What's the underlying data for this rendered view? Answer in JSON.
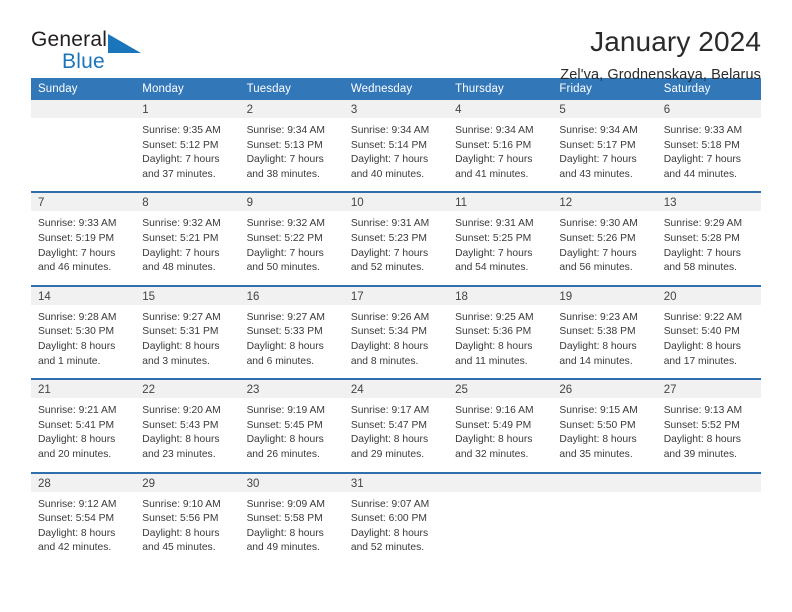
{
  "brand": {
    "name_part1": "General",
    "name_part2": "Blue",
    "accent_color": "#1b75bb"
  },
  "header": {
    "title": "January 2024",
    "subtitle": "Zel'va, Grodnenskaya, Belarus"
  },
  "calendar": {
    "header_bg": "#3277b8",
    "separator_color": "#2f6fad",
    "daynum_bg": "#f1f1f1",
    "weekday_headers": [
      "Sunday",
      "Monday",
      "Tuesday",
      "Wednesday",
      "Thursday",
      "Friday",
      "Saturday"
    ],
    "weeks": [
      [
        {
          "day": "",
          "sunrise": "",
          "sunset": "",
          "daylight1": "",
          "daylight2": ""
        },
        {
          "day": "1",
          "sunrise": "Sunrise: 9:35 AM",
          "sunset": "Sunset: 5:12 PM",
          "daylight1": "Daylight: 7 hours",
          "daylight2": "and 37 minutes."
        },
        {
          "day": "2",
          "sunrise": "Sunrise: 9:34 AM",
          "sunset": "Sunset: 5:13 PM",
          "daylight1": "Daylight: 7 hours",
          "daylight2": "and 38 minutes."
        },
        {
          "day": "3",
          "sunrise": "Sunrise: 9:34 AM",
          "sunset": "Sunset: 5:14 PM",
          "daylight1": "Daylight: 7 hours",
          "daylight2": "and 40 minutes."
        },
        {
          "day": "4",
          "sunrise": "Sunrise: 9:34 AM",
          "sunset": "Sunset: 5:16 PM",
          "daylight1": "Daylight: 7 hours",
          "daylight2": "and 41 minutes."
        },
        {
          "day": "5",
          "sunrise": "Sunrise: 9:34 AM",
          "sunset": "Sunset: 5:17 PM",
          "daylight1": "Daylight: 7 hours",
          "daylight2": "and 43 minutes."
        },
        {
          "day": "6",
          "sunrise": "Sunrise: 9:33 AM",
          "sunset": "Sunset: 5:18 PM",
          "daylight1": "Daylight: 7 hours",
          "daylight2": "and 44 minutes."
        }
      ],
      [
        {
          "day": "7",
          "sunrise": "Sunrise: 9:33 AM",
          "sunset": "Sunset: 5:19 PM",
          "daylight1": "Daylight: 7 hours",
          "daylight2": "and 46 minutes."
        },
        {
          "day": "8",
          "sunrise": "Sunrise: 9:32 AM",
          "sunset": "Sunset: 5:21 PM",
          "daylight1": "Daylight: 7 hours",
          "daylight2": "and 48 minutes."
        },
        {
          "day": "9",
          "sunrise": "Sunrise: 9:32 AM",
          "sunset": "Sunset: 5:22 PM",
          "daylight1": "Daylight: 7 hours",
          "daylight2": "and 50 minutes."
        },
        {
          "day": "10",
          "sunrise": "Sunrise: 9:31 AM",
          "sunset": "Sunset: 5:23 PM",
          "daylight1": "Daylight: 7 hours",
          "daylight2": "and 52 minutes."
        },
        {
          "day": "11",
          "sunrise": "Sunrise: 9:31 AM",
          "sunset": "Sunset: 5:25 PM",
          "daylight1": "Daylight: 7 hours",
          "daylight2": "and 54 minutes."
        },
        {
          "day": "12",
          "sunrise": "Sunrise: 9:30 AM",
          "sunset": "Sunset: 5:26 PM",
          "daylight1": "Daylight: 7 hours",
          "daylight2": "and 56 minutes."
        },
        {
          "day": "13",
          "sunrise": "Sunrise: 9:29 AM",
          "sunset": "Sunset: 5:28 PM",
          "daylight1": "Daylight: 7 hours",
          "daylight2": "and 58 minutes."
        }
      ],
      [
        {
          "day": "14",
          "sunrise": "Sunrise: 9:28 AM",
          "sunset": "Sunset: 5:30 PM",
          "daylight1": "Daylight: 8 hours",
          "daylight2": "and 1 minute."
        },
        {
          "day": "15",
          "sunrise": "Sunrise: 9:27 AM",
          "sunset": "Sunset: 5:31 PM",
          "daylight1": "Daylight: 8 hours",
          "daylight2": "and 3 minutes."
        },
        {
          "day": "16",
          "sunrise": "Sunrise: 9:27 AM",
          "sunset": "Sunset: 5:33 PM",
          "daylight1": "Daylight: 8 hours",
          "daylight2": "and 6 minutes."
        },
        {
          "day": "17",
          "sunrise": "Sunrise: 9:26 AM",
          "sunset": "Sunset: 5:34 PM",
          "daylight1": "Daylight: 8 hours",
          "daylight2": "and 8 minutes."
        },
        {
          "day": "18",
          "sunrise": "Sunrise: 9:25 AM",
          "sunset": "Sunset: 5:36 PM",
          "daylight1": "Daylight: 8 hours",
          "daylight2": "and 11 minutes."
        },
        {
          "day": "19",
          "sunrise": "Sunrise: 9:23 AM",
          "sunset": "Sunset: 5:38 PM",
          "daylight1": "Daylight: 8 hours",
          "daylight2": "and 14 minutes."
        },
        {
          "day": "20",
          "sunrise": "Sunrise: 9:22 AM",
          "sunset": "Sunset: 5:40 PM",
          "daylight1": "Daylight: 8 hours",
          "daylight2": "and 17 minutes."
        }
      ],
      [
        {
          "day": "21",
          "sunrise": "Sunrise: 9:21 AM",
          "sunset": "Sunset: 5:41 PM",
          "daylight1": "Daylight: 8 hours",
          "daylight2": "and 20 minutes."
        },
        {
          "day": "22",
          "sunrise": "Sunrise: 9:20 AM",
          "sunset": "Sunset: 5:43 PM",
          "daylight1": "Daylight: 8 hours",
          "daylight2": "and 23 minutes."
        },
        {
          "day": "23",
          "sunrise": "Sunrise: 9:19 AM",
          "sunset": "Sunset: 5:45 PM",
          "daylight1": "Daylight: 8 hours",
          "daylight2": "and 26 minutes."
        },
        {
          "day": "24",
          "sunrise": "Sunrise: 9:17 AM",
          "sunset": "Sunset: 5:47 PM",
          "daylight1": "Daylight: 8 hours",
          "daylight2": "and 29 minutes."
        },
        {
          "day": "25",
          "sunrise": "Sunrise: 9:16 AM",
          "sunset": "Sunset: 5:49 PM",
          "daylight1": "Daylight: 8 hours",
          "daylight2": "and 32 minutes."
        },
        {
          "day": "26",
          "sunrise": "Sunrise: 9:15 AM",
          "sunset": "Sunset: 5:50 PM",
          "daylight1": "Daylight: 8 hours",
          "daylight2": "and 35 minutes."
        },
        {
          "day": "27",
          "sunrise": "Sunrise: 9:13 AM",
          "sunset": "Sunset: 5:52 PM",
          "daylight1": "Daylight: 8 hours",
          "daylight2": "and 39 minutes."
        }
      ],
      [
        {
          "day": "28",
          "sunrise": "Sunrise: 9:12 AM",
          "sunset": "Sunset: 5:54 PM",
          "daylight1": "Daylight: 8 hours",
          "daylight2": "and 42 minutes."
        },
        {
          "day": "29",
          "sunrise": "Sunrise: 9:10 AM",
          "sunset": "Sunset: 5:56 PM",
          "daylight1": "Daylight: 8 hours",
          "daylight2": "and 45 minutes."
        },
        {
          "day": "30",
          "sunrise": "Sunrise: 9:09 AM",
          "sunset": "Sunset: 5:58 PM",
          "daylight1": "Daylight: 8 hours",
          "daylight2": "and 49 minutes."
        },
        {
          "day": "31",
          "sunrise": "Sunrise: 9:07 AM",
          "sunset": "Sunset: 6:00 PM",
          "daylight1": "Daylight: 8 hours",
          "daylight2": "and 52 minutes."
        },
        {
          "day": "",
          "sunrise": "",
          "sunset": "",
          "daylight1": "",
          "daylight2": ""
        },
        {
          "day": "",
          "sunrise": "",
          "sunset": "",
          "daylight1": "",
          "daylight2": ""
        },
        {
          "day": "",
          "sunrise": "",
          "sunset": "",
          "daylight1": "",
          "daylight2": ""
        }
      ]
    ]
  }
}
